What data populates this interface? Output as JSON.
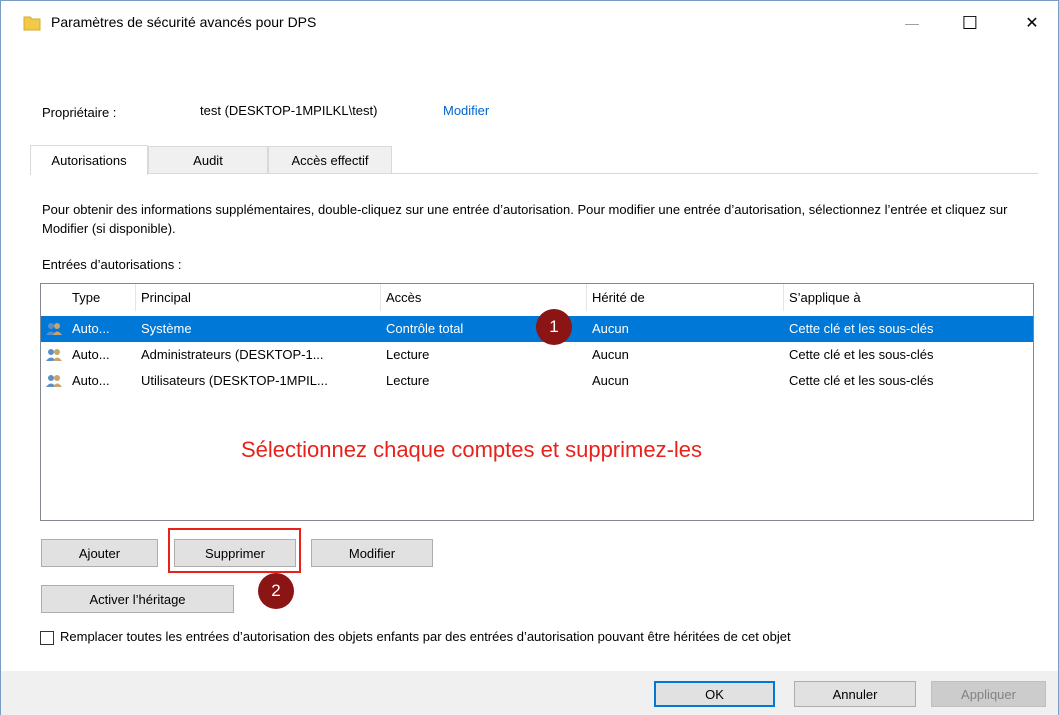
{
  "window": {
    "title": "Paramètres de sécurité avancés pour DPS",
    "minimize_glyph": "—",
    "maximize_glyph": "☐",
    "close_glyph": "✕",
    "folder_color": "#f3c94a"
  },
  "owner": {
    "label": "Propriétaire :",
    "value": "test (DESKTOP-1MPILKL\\test)",
    "change_link": "Modifier"
  },
  "tabs": [
    {
      "label": "Autorisations",
      "active": true
    },
    {
      "label": "Audit",
      "active": false
    },
    {
      "label": "Accès effectif",
      "active": false
    }
  ],
  "info_text": "Pour obtenir des informations supplémentaires, double-cliquez sur une entrée d’autorisation. Pour modifier une entrée d’autorisation, sélectionnez l’entrée et cliquez sur Modifier (si disponible).",
  "entries_label": "Entrées d’autorisations :",
  "table": {
    "columns": [
      "Type",
      "Principal",
      "Accès",
      "Hérité de",
      "S’applique à"
    ],
    "rows": [
      {
        "type": "Auto...",
        "principal": "Système",
        "access": "Contrôle total",
        "inherited": "Aucun",
        "applies": "Cette clé et les sous-clés",
        "selected": true
      },
      {
        "type": "Auto...",
        "principal": "Administrateurs (DESKTOP-1...",
        "access": "Lecture",
        "inherited": "Aucun",
        "applies": "Cette clé et les sous-clés",
        "selected": false
      },
      {
        "type": "Auto...",
        "principal": "Utilisateurs (DESKTOP-1MPIL...",
        "access": "Lecture",
        "inherited": "Aucun",
        "applies": "Cette clé et les sous-clés",
        "selected": false
      }
    ]
  },
  "annotation": "Sélectionnez chaque comptes et supprimez-les",
  "badges": [
    "1",
    "2"
  ],
  "buttons": {
    "add": "Ajouter",
    "remove": "Supprimer",
    "edit": "Modifier",
    "enable_inheritance": "Activer l’héritage",
    "ok": "OK",
    "cancel": "Annuler",
    "apply": "Appliquer"
  },
  "checkbox_label": "Remplacer toutes les entrées d’autorisation des objets enfants par des entrées d’autorisation pouvant être héritées de cet objet",
  "colors": {
    "selection": "#0078d7",
    "annotation": "#e8221a",
    "badge": "#8b1515",
    "link": "#0066cc"
  }
}
